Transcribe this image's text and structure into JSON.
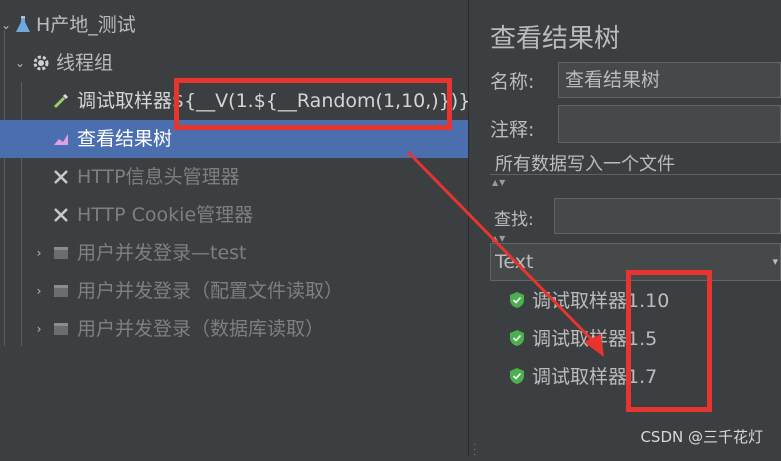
{
  "tree": {
    "items": [
      {
        "label": "H产地_测试"
      },
      {
        "label": "线程组"
      },
      {
        "label": "调试取样器${__V(1.${__Random(1,10,)})}"
      },
      {
        "label": "查看结果树"
      },
      {
        "label": "HTTP信息头管理器"
      },
      {
        "label": "HTTP Cookie管理器"
      },
      {
        "label": "用户并发登录—test"
      },
      {
        "label": "用户并发登录（配置文件读取）"
      },
      {
        "label": "用户并发登录（数据库读取）"
      }
    ]
  },
  "panel": {
    "title": "查看结果树",
    "name_label": "名称:",
    "name_value": "查看结果树",
    "comment_label": "注释:",
    "comment_value": "",
    "file_section": "所有数据写入一个文件",
    "search_label": "查找:",
    "search_value": "",
    "renderer_value": "Text"
  },
  "results": [
    {
      "label": "调试取样器1.10",
      "status": "success"
    },
    {
      "label": "调试取样器1.5",
      "status": "success"
    },
    {
      "label": "调试取样器1.7",
      "status": "success"
    }
  ],
  "watermark": "CSDN @三千花灯",
  "colors": {
    "background": "#3c3f41",
    "selection": "#4b6eaf",
    "annotation": "#e8342e",
    "success": "#4caf50"
  }
}
